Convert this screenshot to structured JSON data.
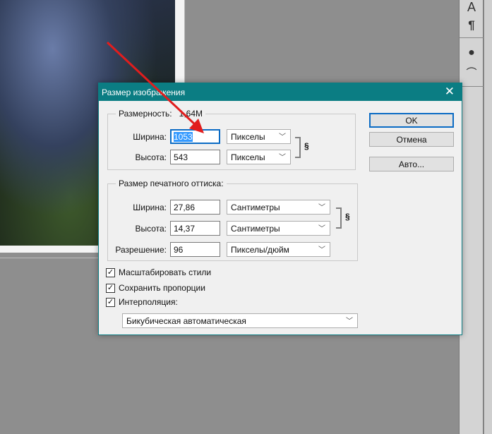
{
  "dialog": {
    "title": "Размер изображения",
    "close": "✕"
  },
  "dimensions": {
    "legend": "Размерность:",
    "size": "1,64M",
    "width_label": "Ширина:",
    "width_value": "1053",
    "width_unit": "Пикселы",
    "height_label": "Высота:",
    "height_value": "543",
    "height_unit": "Пикселы"
  },
  "print": {
    "legend": "Размер печатного оттиска:",
    "width_label": "Ширина:",
    "width_value": "27,86",
    "width_unit": "Сантиметры",
    "height_label": "Высота:",
    "height_value": "14,37",
    "height_unit": "Сантиметры",
    "res_label": "Разрешение:",
    "res_value": "96",
    "res_unit": "Пикселы/дюйм"
  },
  "options": {
    "scale_styles": "Масштабировать стили",
    "constrain": "Сохранить пропорции",
    "resample": "Интерполяция:",
    "resample_method": "Бикубическая автоматическая"
  },
  "buttons": {
    "ok": "OK",
    "cancel": "Отмена",
    "auto": "Авто..."
  },
  "tools": {
    "type": "A",
    "paragraph": "¶"
  },
  "annotation_color": "#e11d1d"
}
